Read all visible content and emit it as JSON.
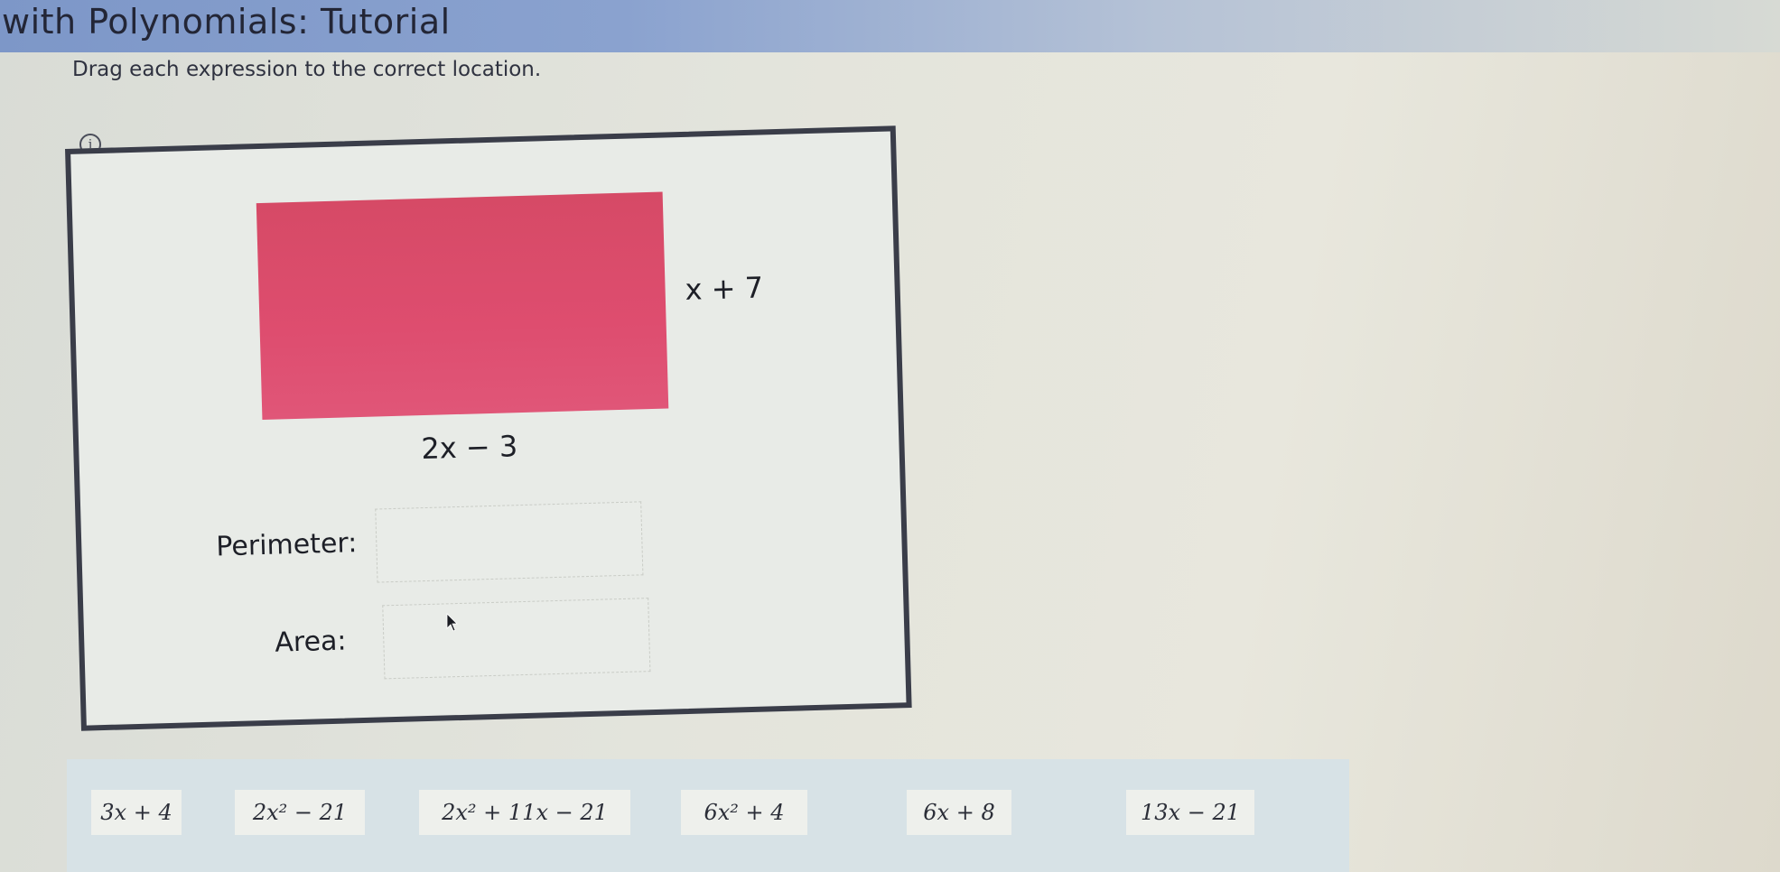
{
  "header": {
    "title": "with Polynomials: Tutorial"
  },
  "instruction": "Drag each expression to the correct location.",
  "info": {
    "icon": "info-icon",
    "symbol": "i"
  },
  "figure": {
    "rect_color": "#de4d6f",
    "height_label": "x + 7",
    "width_label": "2x − 3"
  },
  "fields": {
    "perimeter_label": "Perimeter:",
    "area_label": "Area:"
  },
  "tiles": [
    {
      "label": "3x + 4"
    },
    {
      "label": "2x² − 21"
    },
    {
      "label": "2x² + 11x − 21"
    },
    {
      "label": "6x² + 4"
    },
    {
      "label": "6x + 8"
    },
    {
      "label": "13x − 21"
    }
  ],
  "colors": {
    "panel_border": "#3a3d49",
    "title_bar": "#7d97c8",
    "tray": "#d7e2e6"
  }
}
